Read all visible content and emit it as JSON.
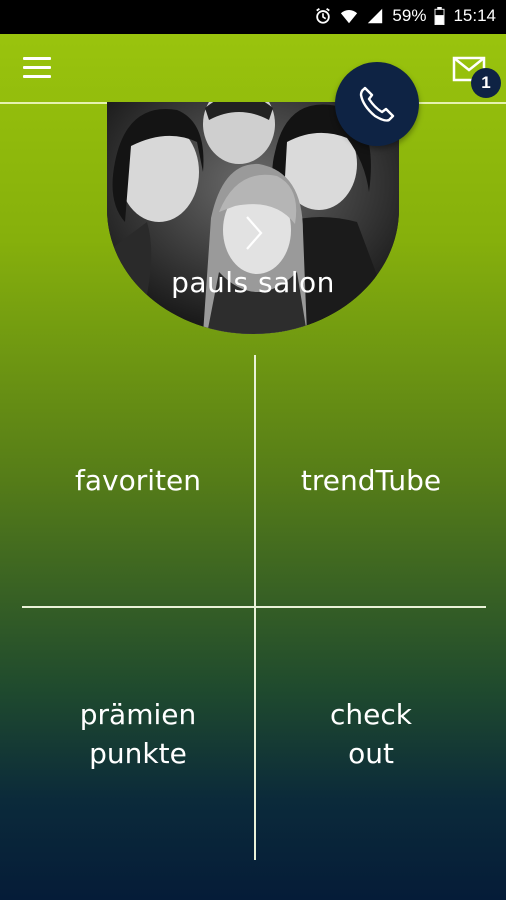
{
  "status_bar": {
    "battery": "59%",
    "time": "15:14",
    "icons": [
      "alarm-icon",
      "wifi-icon",
      "signal-icon",
      "battery-icon"
    ]
  },
  "app_bar": {
    "menu_icon": "hamburger-menu-icon",
    "mail_icon": "mail-icon",
    "unread_count": "1"
  },
  "salon": {
    "name": "pauls salon",
    "arrow_icon": "chevron-right-icon",
    "phone_icon": "phone-icon"
  },
  "tiles": [
    {
      "lines": [
        "favoriten"
      ]
    },
    {
      "lines": [
        "trendTube"
      ]
    },
    {
      "lines": [
        "prämien",
        "punkte"
      ]
    },
    {
      "lines": [
        "check",
        "out"
      ]
    }
  ],
  "colors": {
    "gradient_top": "#9dc70d",
    "gradient_bottom": "#051c38",
    "accent_navy": "#0e2344"
  }
}
